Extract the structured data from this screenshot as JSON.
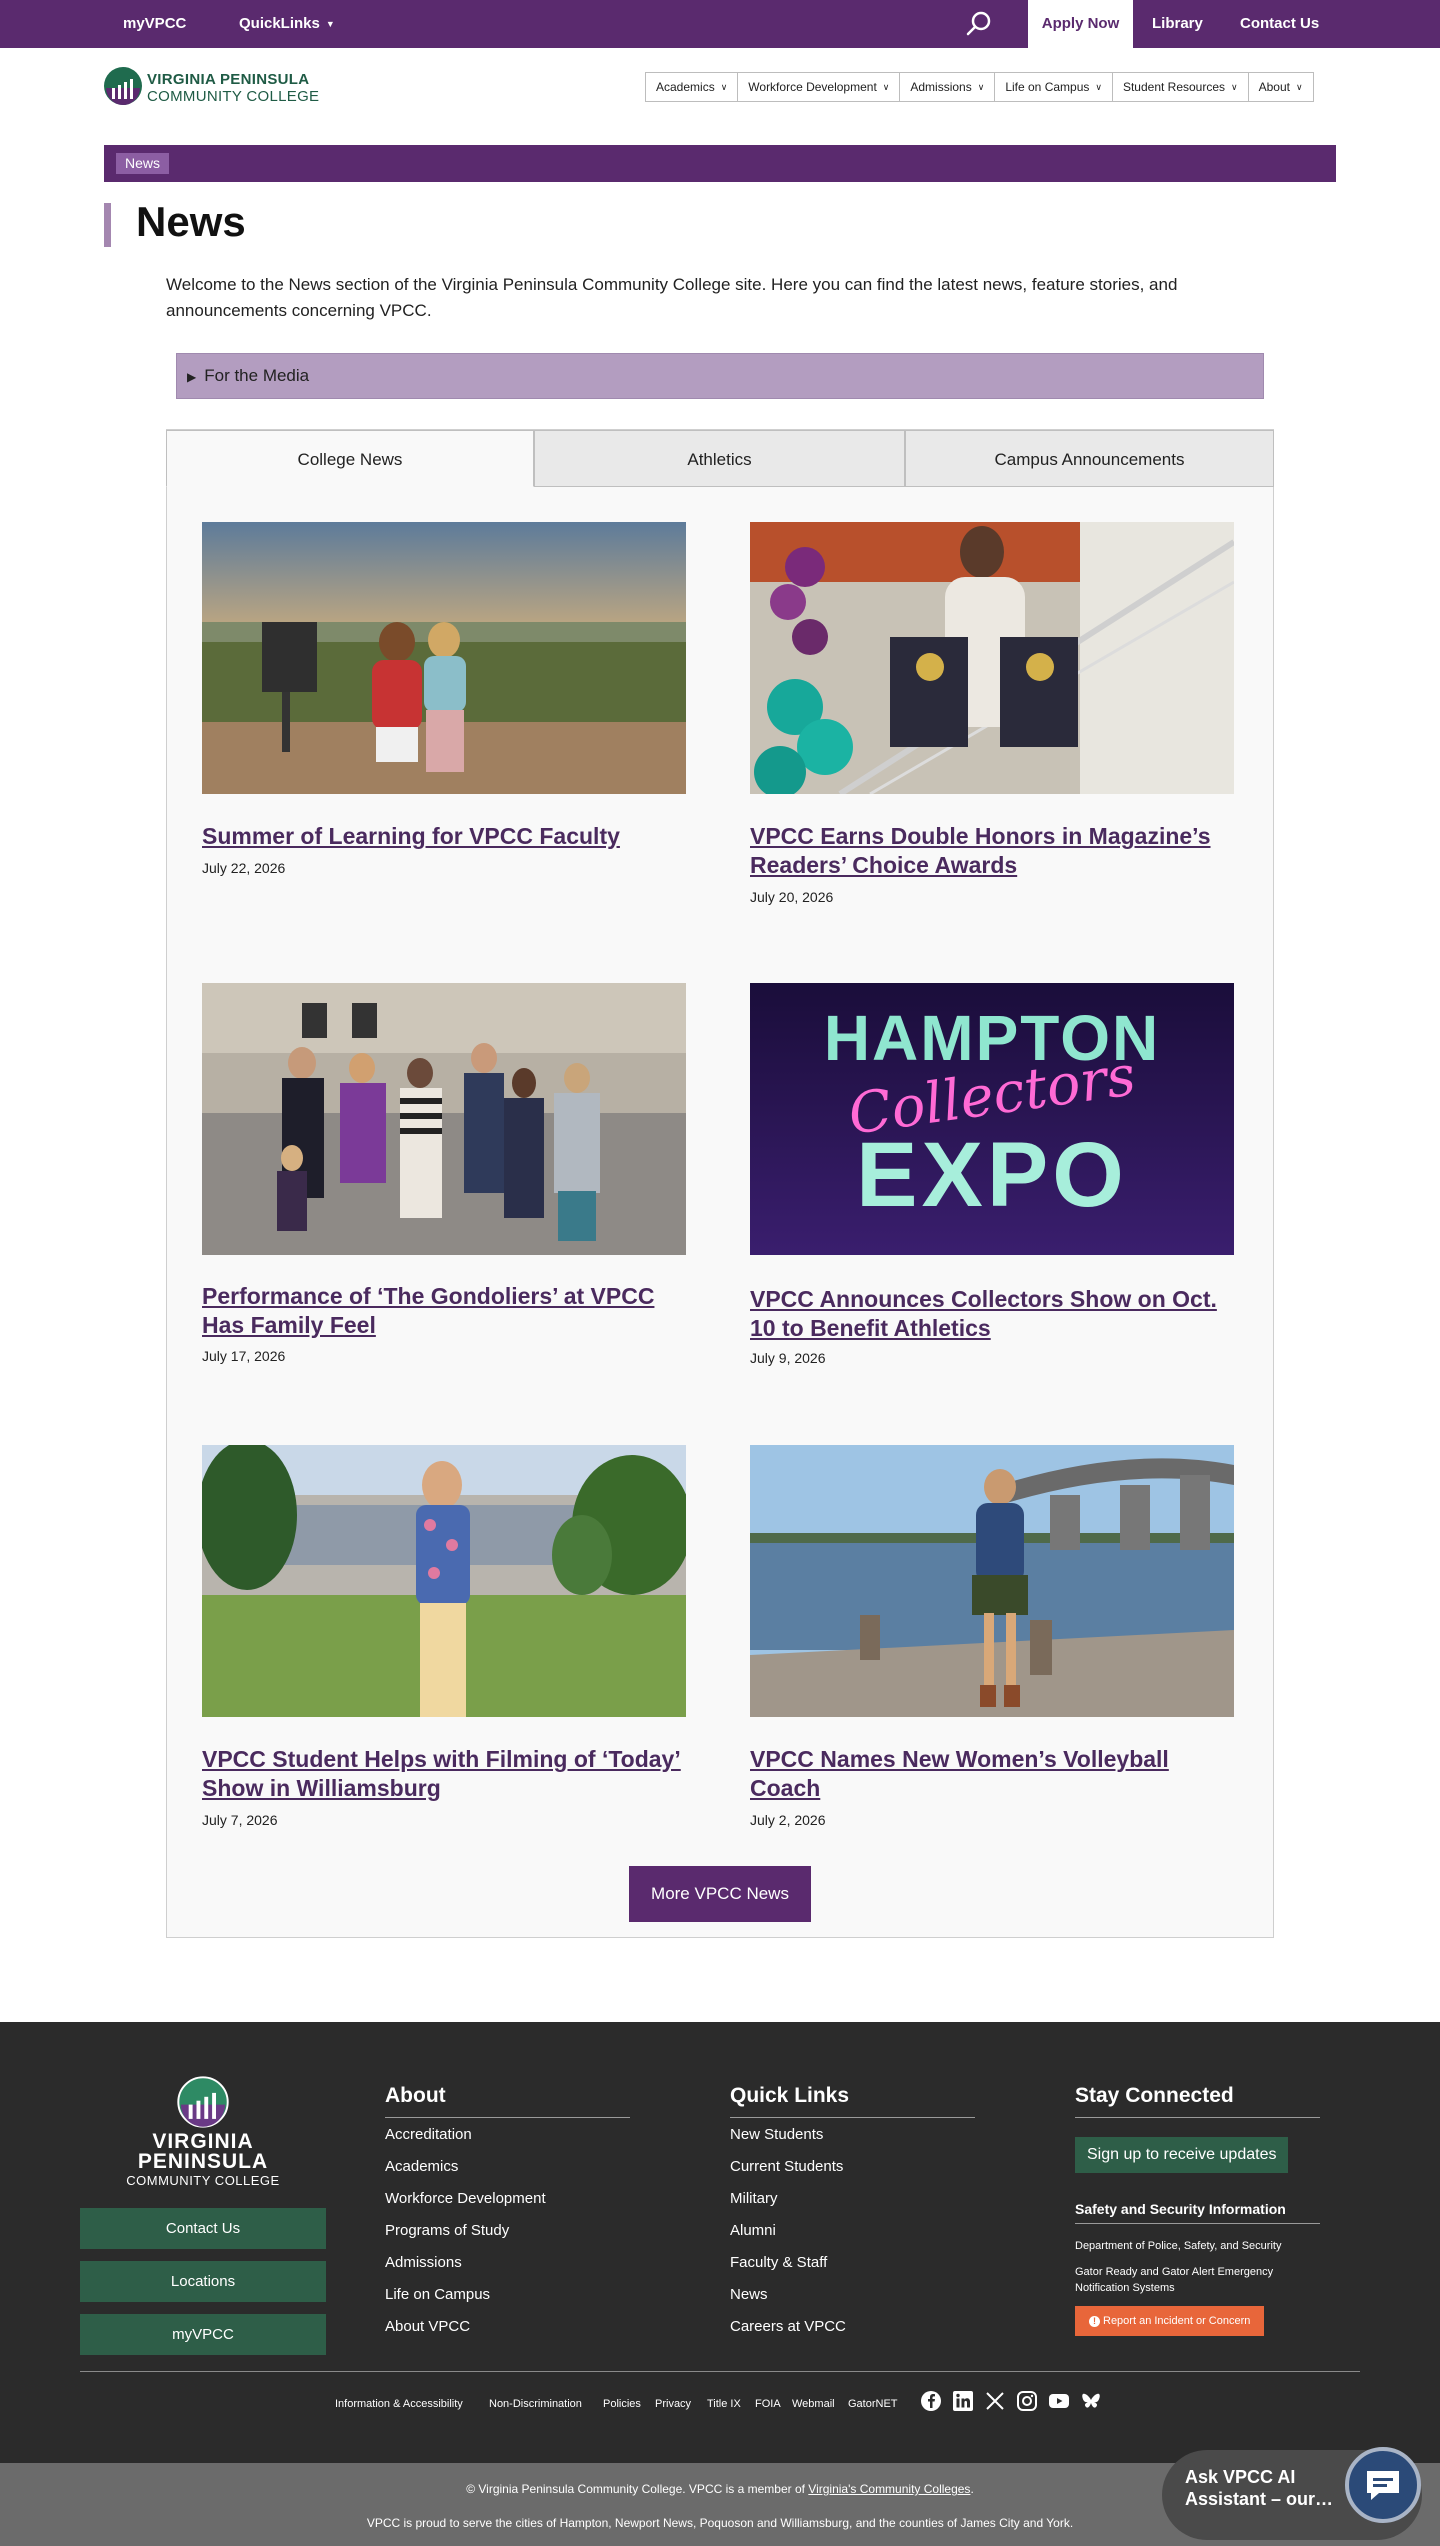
{
  "topbar": {
    "myvpcc": "myVPCC",
    "quicklinks": "QuickLinks",
    "apply": "Apply Now",
    "library": "Library",
    "contact": "Contact Us"
  },
  "logo": {
    "line1": "VIRGINIA PENINSULA",
    "line2": "COMMUNITY COLLEGE"
  },
  "nav": [
    "Academics",
    "Workforce Development",
    "Admissions",
    "Life on Campus",
    "Student Resources",
    "About"
  ],
  "breadcrumb": "News",
  "page": {
    "title": "News",
    "intro": "Welcome to the News section of the Virginia Peninsula Community College site. Here you can find the latest news, feature stories, and announcements concerning VPCC.",
    "media": "For the Media"
  },
  "tabs": [
    "College News",
    "Athletics",
    "Campus Announcements"
  ],
  "news": [
    {
      "title": "Summer of Learning for VPCC Faculty",
      "date": "July 22, 2026"
    },
    {
      "title": "VPCC Earns Double Honors in Magazine’s Readers’ Choice Awards",
      "date": "July 20, 2026"
    },
    {
      "title": "Performance of ‘The Gondoliers’ at VPCC Has Family Feel",
      "date": "July 17, 2026"
    },
    {
      "title": "VPCC Announces Collectors Show on Oct. 10 to Benefit Athletics",
      "date": "July 9, 2026"
    },
    {
      "title": "VPCC Student Helps with Filming of ‘Today’ Show in Williamsburg",
      "date": "July 7, 2026"
    },
    {
      "title": "VPCC Names New Women’s Volleyball Coach",
      "date": "July 2, 2026"
    }
  ],
  "expo": {
    "top": "HAMPTON",
    "script": "Collectors",
    "bottom": "EXPO"
  },
  "more_button": "More VPCC News",
  "footer": {
    "logo": {
      "line1": "VIRGINIA",
      "line2": "PENINSULA",
      "line3": "COMMUNITY COLLEGE"
    },
    "buttons": [
      "Contact Us",
      "Locations",
      "myVPCC"
    ],
    "about": {
      "heading": "About",
      "links": [
        "Accreditation",
        "Academics",
        "Workforce Development",
        "Programs of Study",
        "Admissions",
        "Life on Campus",
        "About VPCC"
      ]
    },
    "quicklinks": {
      "heading": "Quick Links",
      "links": [
        "New Students",
        "Current Students",
        "Military",
        "Alumni",
        "Faculty & Staff",
        "News",
        "Careers at VPCC"
      ]
    },
    "stay": {
      "heading": "Stay Connected",
      "signup": "Sign up to receive updates",
      "safety_heading": "Safety and Security Information",
      "safety_links": [
        "Department of Police, Safety, and Security",
        "Gator Ready and Gator Alert Emergency Notification Systems"
      ],
      "report": "Report an Incident or Concern"
    },
    "legal": [
      "Information & Accessibility",
      "Non-Discrimination",
      "Policies",
      "Privacy",
      "Title IX",
      "FOIA",
      "Webmail",
      "GatorNET"
    ],
    "social": [
      "facebook-icon",
      "linkedin-icon",
      "x-icon",
      "instagram-icon",
      "youtube-icon",
      "bluesky-icon"
    ]
  },
  "bottom": {
    "copyright_pre": "© Virginia Peninsula Community College. VPCC is a member of ",
    "copyright_link": "Virginia's Community Colleges",
    "copyright_post": ".",
    "serve": "VPCC is proud to serve the cities of Hampton, Newport News, Poquoson and Williamsburg, and the counties of James City and York."
  },
  "chat": {
    "label": "Ask VPCC AI Assistant – our…"
  },
  "colors": {
    "brand_purple": "#5a2a6e",
    "footer_green": "#2e5e48",
    "report_orange": "#e8663a"
  }
}
